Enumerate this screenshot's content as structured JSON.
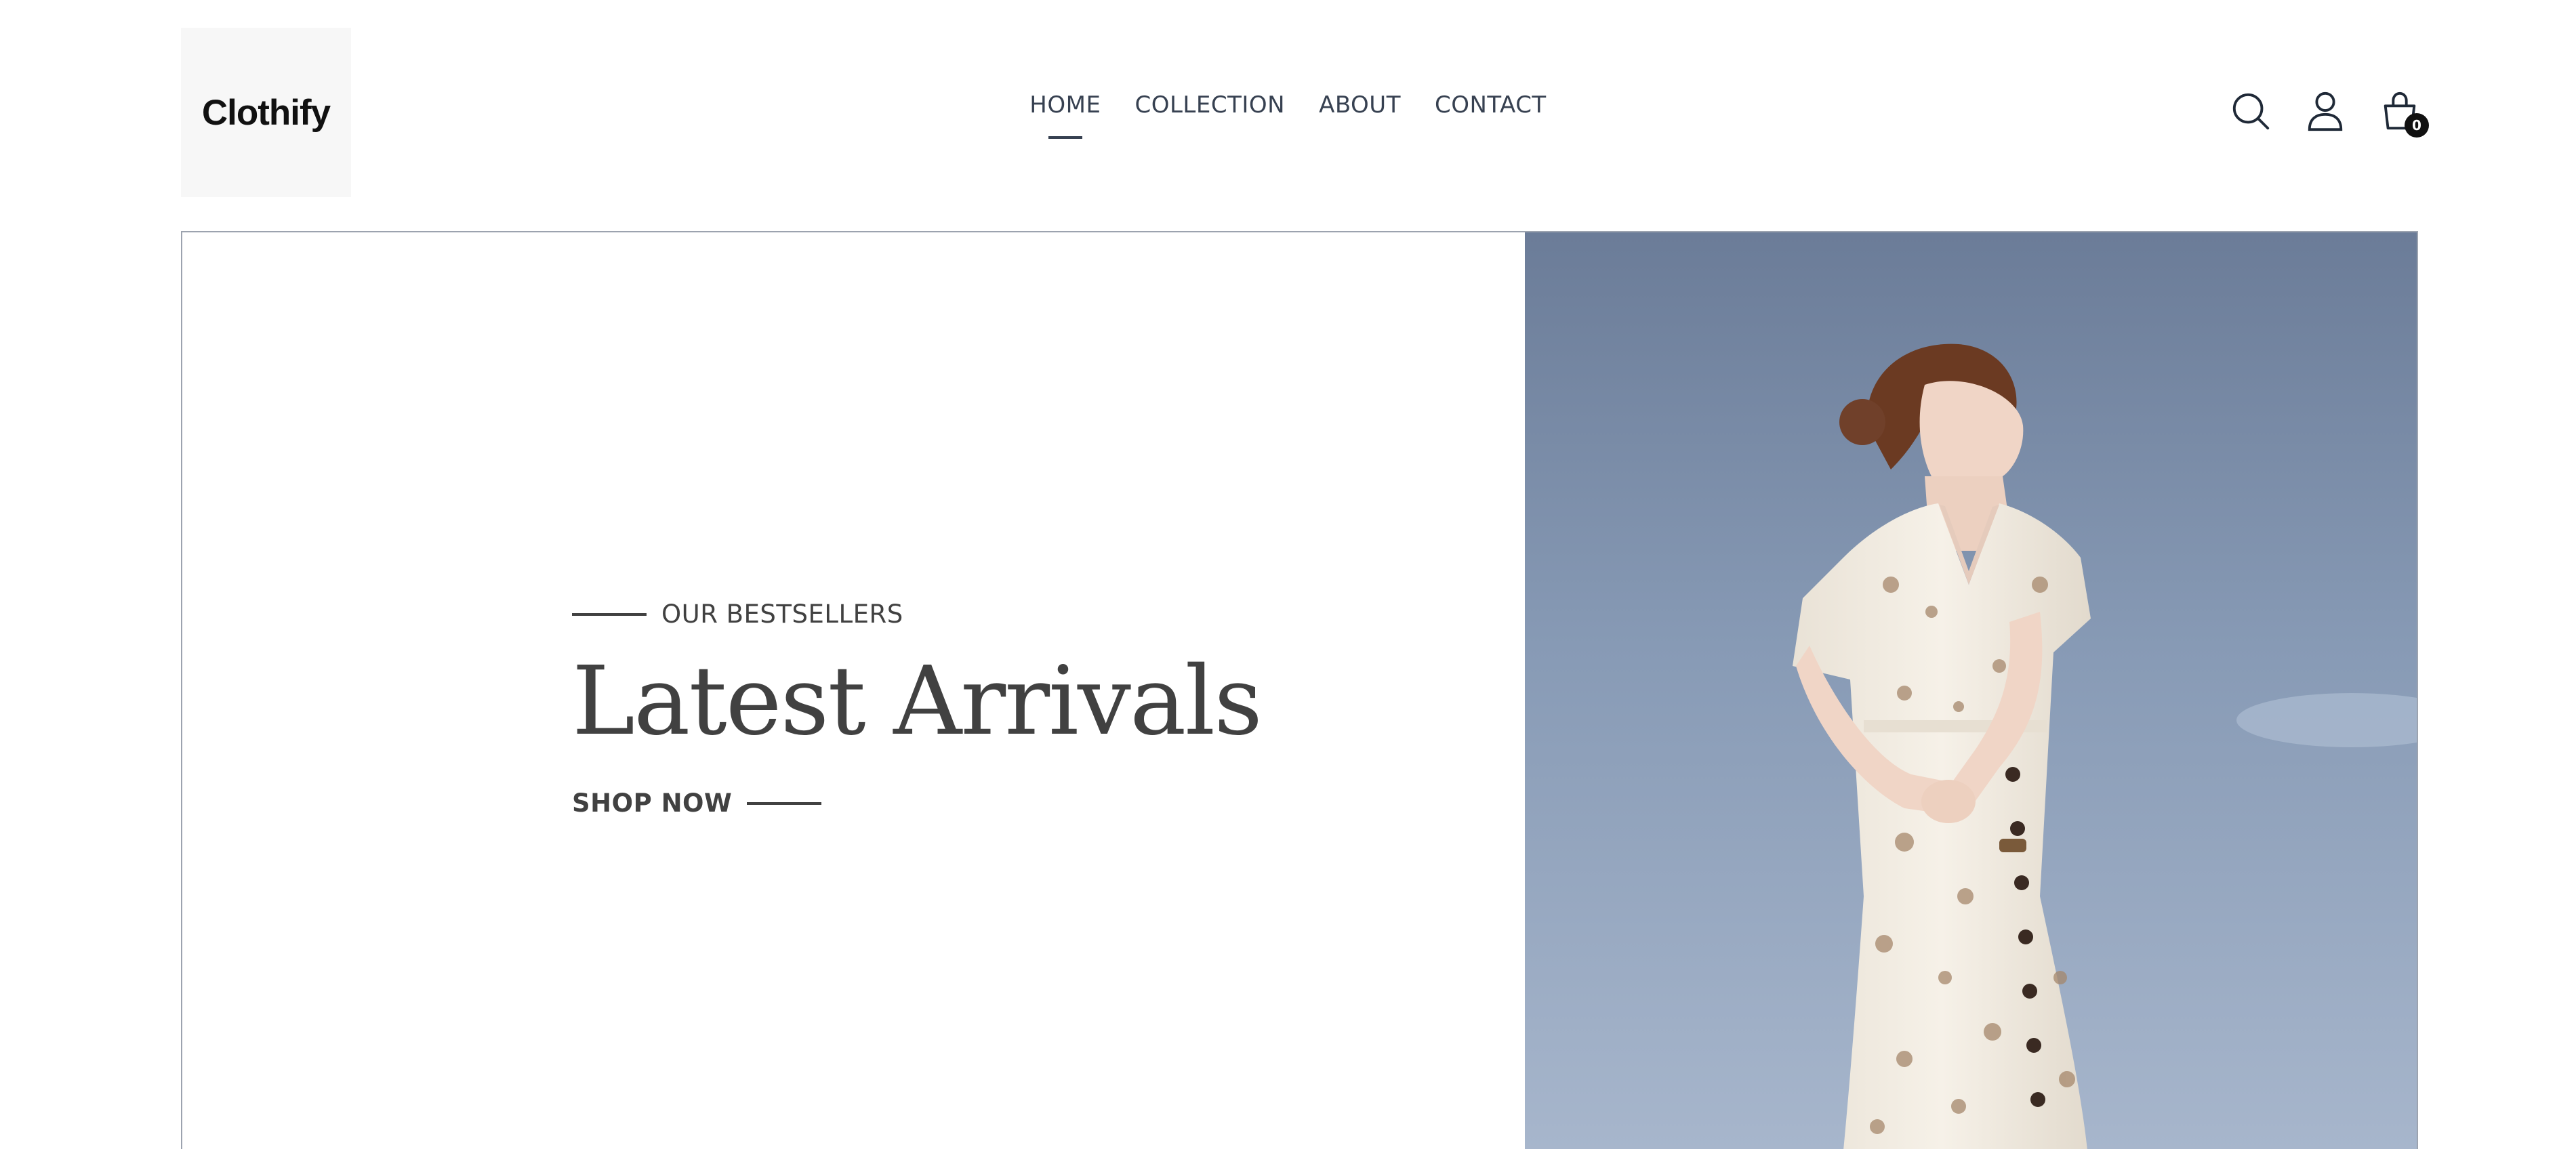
{
  "brand": {
    "name": "Clothify"
  },
  "nav": {
    "items": [
      {
        "label": "HOME",
        "active": true
      },
      {
        "label": "COLLECTION",
        "active": false
      },
      {
        "label": "ABOUT",
        "active": false
      },
      {
        "label": "CONTACT",
        "active": false
      }
    ]
  },
  "header_icons": {
    "search": "search-icon",
    "profile": "user-icon",
    "cart": "shopping-bag-icon",
    "cart_count": "0"
  },
  "hero": {
    "eyebrow": "OUR BESTSELLERS",
    "title": "Latest Arrivals",
    "cta": "SHOP NOW",
    "image": "woman-in-floral-dress-against-sky"
  },
  "colors": {
    "text": "#414141",
    "nav_text": "#374151",
    "border": "#9ca3af",
    "badge": "#111111",
    "sky": "#8497b2"
  }
}
